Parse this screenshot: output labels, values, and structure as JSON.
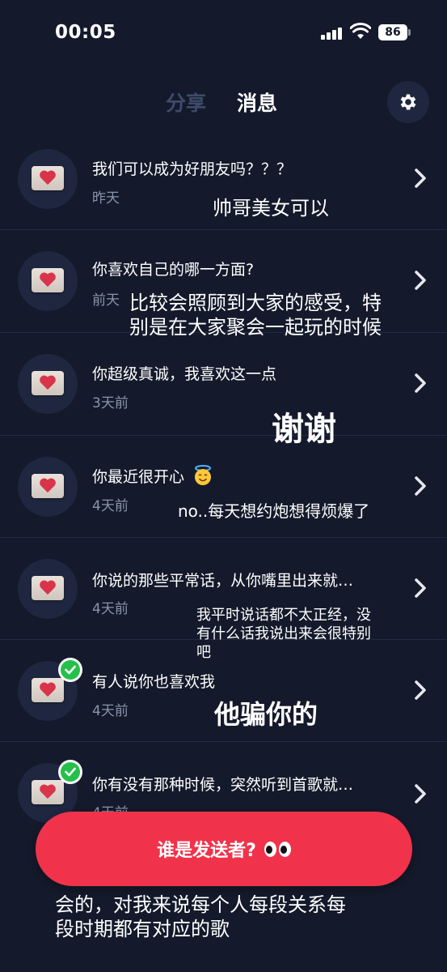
{
  "status_bar": {
    "time": "00:05",
    "battery": "86"
  },
  "header": {
    "tab_share": "分享",
    "tab_messages": "消息"
  },
  "messages": [
    {
      "title": "我们可以成为好朋友吗？？？",
      "time": "昨天",
      "verified": false,
      "note": "帅哥美女可以"
    },
    {
      "title": "你喜欢自己的哪一方面?",
      "time": "前天",
      "verified": false,
      "note_line1": "比较会照顾到大家的感受，特",
      "note_line2": "别是在大家聚会一起玩的时候"
    },
    {
      "title": "你超级真诚，我喜欢这一点",
      "time": "3天前",
      "verified": false,
      "note": "谢谢"
    },
    {
      "title": "你最近很开心",
      "time": "4天前",
      "verified": false,
      "note": "no..每天想约炮想得烦爆了"
    },
    {
      "title": "你说的那些平常话，从你嘴里出来就…",
      "time": "4天前",
      "verified": false,
      "note_line1": "我平时说话都不太正经，没",
      "note_line2": "有什么话我说出来会很特别",
      "note_line3": "吧"
    },
    {
      "title": "有人说你也喜欢我",
      "time": "4天前",
      "verified": true,
      "note": "他骗你的"
    },
    {
      "title": "你有没有那种时候，突然听到首歌就…",
      "time": "4天前",
      "verified": true
    }
  ],
  "bottom": {
    "sender_button": "谁是发送者?",
    "note_line1": "会的，对我来说每个人每段关系每",
    "note_line2": "段时期都有对应的歌"
  },
  "icons": {
    "settings": "gear-icon",
    "avatar": "heart-envelope-icon",
    "chevron": "chevron-right-icon",
    "verified": "check-circle-icon",
    "emoji": "smiling-face-with-halo",
    "eyes": "eyes-emoji"
  },
  "colors": {
    "background": "#141a2b",
    "accent": "#f0334b",
    "muted_text": "#8a93ab",
    "verified": "#25c04a"
  }
}
